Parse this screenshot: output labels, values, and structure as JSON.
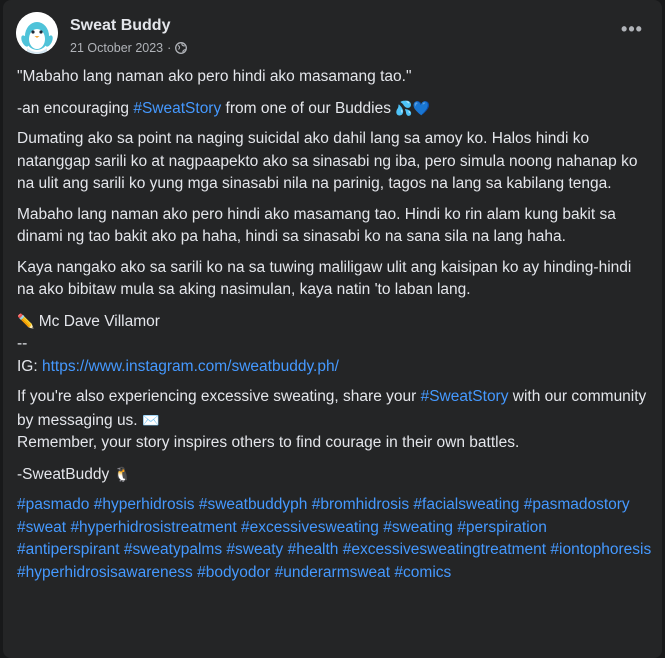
{
  "post": {
    "author": "Sweat Buddy",
    "date": "21 October 2023",
    "separator": "·",
    "privacy_icon": "globe-icon",
    "more_icon": "ellipsis-icon",
    "more_label": "•••"
  },
  "body": {
    "quote": "\"Mabaho lang naman ako pero hindi ako masamang tao.\"",
    "intro_before": "-an encouraging ",
    "intro_tag": "#SweatStory",
    "intro_after": " from one of our Buddies ",
    "intro_emoji": "💦💙",
    "para1": "Dumating ako sa point na naging suicidal ako dahil lang sa amoy ko. Halos hindi ko natanggap sarili ko at nagpaapekto ako sa sinasabi ng iba, pero simula noong nahanap ko na ulit ang sarili ko yung mga sinasabi nila na parinig, tagos na lang sa kabilang tenga.",
    "para2": "Mabaho lang naman ako pero hindi ako masamang tao. Hindi ko rin alam kung bakit sa dinami ng tao bakit ako pa haha, hindi sa sinasabi ko na sana sila na lang haha.",
    "para3": "Kaya nangako ako sa sarili ko na sa tuwing maliligaw ulit ang kaisipan ko ay hinding-hindi na ako bibitaw mula sa aking nasimulan, kaya natin 'to laban lang.",
    "author_emoji": "✏️",
    "author_line": "Mc Dave Villamor",
    "dashes": "--",
    "ig_label": "IG: ",
    "ig_link": "https://www.instagram.com/sweatbuddy.ph/",
    "cta_before": "If you're also experiencing excessive sweating, share your ",
    "cta_tag": "#SweatStory",
    "cta_after": " with our community by messaging us. ",
    "cta_emoji": "✉️",
    "remember": "Remember, your story inspires others to find courage in their own battles.",
    "signoff": "-SweatBuddy ",
    "signoff_emoji": "🐧",
    "hashtags": [
      "#pasmado",
      "#hyperhidrosis",
      "#sweatbuddyph",
      "#bromhidrosis",
      "#facialsweating",
      "#pasmadostory",
      "#sweat",
      "#hyperhidrosistreatment",
      "#excessivesweating",
      "#sweating",
      "#perspiration",
      "#antiperspirant",
      "#sweatypalms",
      "#sweaty",
      "#health",
      "#excessivesweatingtreatment",
      "#iontophoresis",
      "#hyperhidrosisawareness",
      "#bodyodor",
      "#underarmsweat",
      "#comics"
    ]
  },
  "colors": {
    "background": "#18191a",
    "card": "#242526",
    "text": "#e4e6eb",
    "secondary_text": "#b0b3b8",
    "link": "#4599ff"
  }
}
